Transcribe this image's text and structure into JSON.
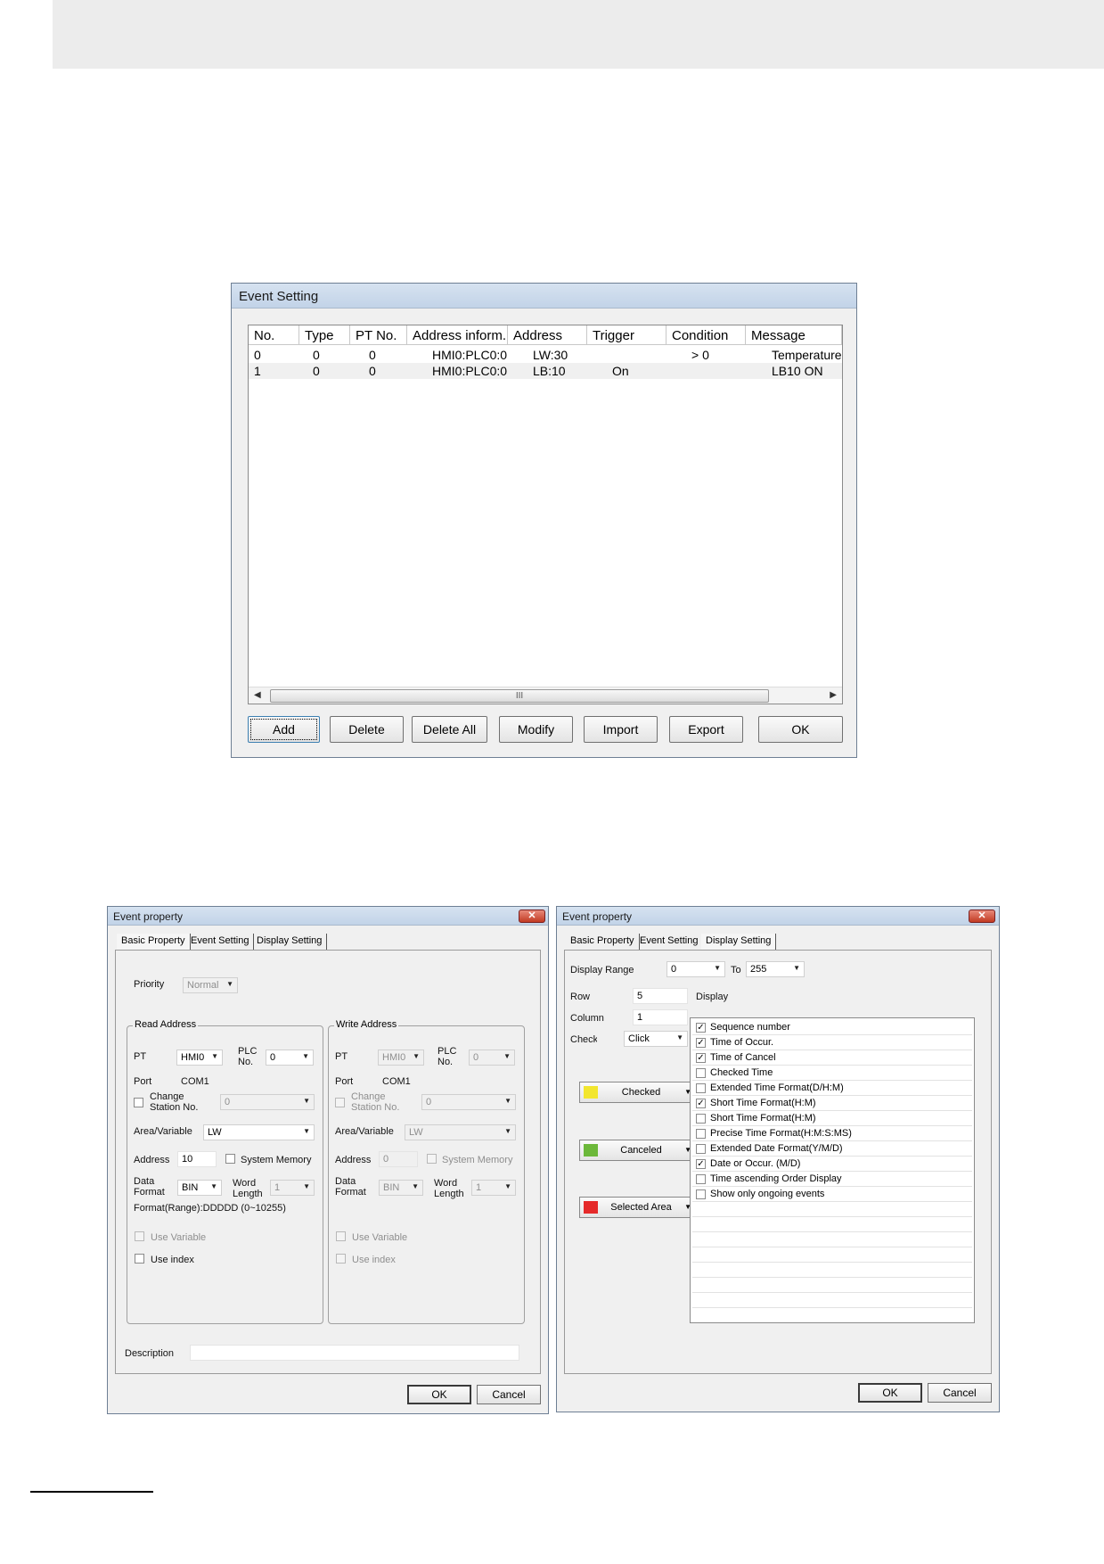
{
  "event_setting": {
    "title": "Event Setting",
    "columns": [
      "No.",
      "Type",
      "PT No.",
      "Address inform...",
      "Address",
      "Trigger",
      "Condition",
      "Message"
    ],
    "rows": [
      [
        "0",
        "0",
        "0",
        "HMI0:PLC0:0",
        "LW:30",
        "",
        "> 0",
        "Temperature"
      ],
      [
        "1",
        "0",
        "0",
        "HMI0:PLC0:0",
        "LB:10",
        "On",
        "",
        "LB10 ON"
      ]
    ],
    "scrollbar_grip": "III",
    "buttons": {
      "add": "Add",
      "delete": "Delete",
      "delete_all": "Delete All",
      "modify": "Modify",
      "import": "Import",
      "export": "Export",
      "ok": "OK"
    }
  },
  "basic_dialog": {
    "title": "Event property",
    "tabs": [
      "Basic Property",
      "Event Setting",
      "Display Setting"
    ],
    "priority_label": "Priority",
    "priority_value": "Normal",
    "read": {
      "group_title": "Read Address",
      "pt_label": "PT",
      "pt_value": "HMI0",
      "plc_label": "PLC\nNo.",
      "plc_value": "0",
      "port_label": "Port",
      "port_value": "COM1",
      "change_station_label": "Change\nStation No.",
      "station_value": "0",
      "area_label": "Area/Variable",
      "area_value": "LW",
      "address_label": "Address",
      "address_value": "10",
      "system_memory_label": "System Memory",
      "data_format_label": "Data\nFormat",
      "data_format_value": "BIN",
      "word_length_label": "Word\nLength",
      "word_length_value": "1",
      "format_range": "Format(Range):DDDDD (0~10255)",
      "use_variable": "Use Variable",
      "use_index": "Use index"
    },
    "write": {
      "group_title": "Write Address",
      "pt_label": "PT",
      "pt_value": "HMI0",
      "plc_label": "PLC\nNo.",
      "plc_value": "0",
      "port_label": "Port",
      "port_value": "COM1",
      "change_station_label": "Change\nStation No.",
      "station_value": "0",
      "area_label": "Area/Variable",
      "area_value": "LW",
      "address_label": "Address",
      "address_value": "0",
      "system_memory_label": "System Memory",
      "data_format_label": "Data\nFormat",
      "data_format_value": "BIN",
      "word_length_label": "Word\nLength",
      "word_length_value": "1",
      "use_variable": "Use Variable",
      "use_index": "Use index"
    },
    "description_label": "Description",
    "description_value": "",
    "ok": "OK",
    "cancel": "Cancel"
  },
  "display_dialog": {
    "title": "Event property",
    "tabs": [
      "Basic Property",
      "Event Setting",
      "Display Setting"
    ],
    "display_range_label": "Display Range",
    "range_from": "0",
    "to_label": "To",
    "range_to": "255",
    "row_label": "Row",
    "row_value": "5",
    "column_label": "Column",
    "column_value": "1",
    "check_label": "Check",
    "check_value": "Click",
    "display_label": "Display",
    "color_buttons": [
      {
        "label": "Checked",
        "color": "#f2e62e"
      },
      {
        "label": "Canceled",
        "color": "#6cb83a"
      },
      {
        "label": "Selected Area",
        "color": "#e52a2a"
      }
    ],
    "display_items": [
      {
        "label": "Sequence number",
        "checked": true
      },
      {
        "label": "Time of Occur.",
        "checked": true
      },
      {
        "label": "Time of Cancel",
        "checked": true
      },
      {
        "label": "Checked Time",
        "checked": false
      },
      {
        "label": "Extended Time Format(D/H:M)",
        "checked": false
      },
      {
        "label": "Short Time Format(H:M)",
        "checked": true
      },
      {
        "label": "Short Time Format(H:M)",
        "checked": false
      },
      {
        "label": "Precise Time Format(H:M:S:MS)",
        "checked": false
      },
      {
        "label": "Extended Date Format(Y/M/D)",
        "checked": false
      },
      {
        "label": "Date or Occur. (M/D)",
        "checked": true
      },
      {
        "label": "Time ascending Order Display",
        "checked": false
      },
      {
        "label": "Show only ongoing events",
        "checked": false
      }
    ],
    "ok": "OK",
    "cancel": "Cancel"
  },
  "icons": {
    "close": "close-icon",
    "dropdown": "chevron-down-icon",
    "check": "checkmark-icon"
  },
  "colors": {
    "title_bar": "#c9d8ea",
    "dialog_bg": "#f0f0f0",
    "close_red": "#c23a22"
  }
}
